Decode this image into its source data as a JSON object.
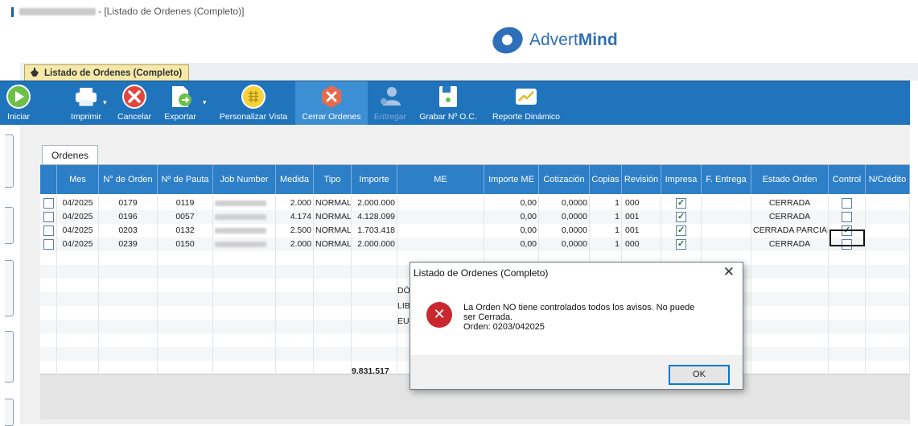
{
  "window": {
    "title": "- [Listado de Ordenes (Completo)]"
  },
  "logo": {
    "text_regular": "Advert",
    "text_bold": "Mind"
  },
  "doc_tab": {
    "label": "Listado de Ordenes (Completo)"
  },
  "ribbon": {
    "iniciar": "Iniciar",
    "imprimir": "Imprimir",
    "cancelar": "Cancelar",
    "exportar": "Exportar",
    "personalizar": "Personalizar Vista",
    "cerrar": "Cerrar Ordenes",
    "entregar": "Entregar",
    "grabar": "Grabar Nº O.C.",
    "reporte": "Reporte Dinámico"
  },
  "subtab": {
    "label": "Ordenes"
  },
  "columns": [
    "Mes",
    "N° de Orden",
    "Nº de Pauta",
    "Job Number",
    "Medida",
    "Tipo",
    "Importe",
    "ME",
    "Importe ME",
    "Cotización",
    "Copias",
    "Revisión",
    "Impresa",
    "F. Entrega",
    "Estado Orden",
    "Control",
    "N/Crédito"
  ],
  "rows": [
    {
      "sel": false,
      "mes": "04/2025",
      "orden": "0179",
      "pauta": "0119",
      "medida": "2.000",
      "tipo": "NORMAL",
      "importe": "2.000.000",
      "importe_me": "0,00",
      "cotizacion": "0,0000",
      "copias": "1",
      "revision": "000",
      "impresa": true,
      "estado": "CERRADA",
      "control": false
    },
    {
      "sel": false,
      "mes": "04/2025",
      "orden": "0196",
      "pauta": "0057",
      "medida": "4.174",
      "tipo": "NORMAL",
      "importe": "4.128.099",
      "importe_me": "0,00",
      "cotizacion": "0,0000",
      "copias": "1",
      "revision": "001",
      "impresa": true,
      "estado": "CERRADA",
      "control": false
    },
    {
      "sel": false,
      "mes": "04/2025",
      "orden": "0203",
      "pauta": "0132",
      "medida": "2.500",
      "tipo": "NORMAL",
      "importe": "1.703.418",
      "importe_me": "0,00",
      "cotizacion": "0,0000",
      "copias": "1",
      "revision": "001",
      "impresa": true,
      "estado": "CERRADA PARCIAL",
      "control": true
    },
    {
      "sel": false,
      "mes": "04/2025",
      "orden": "0239",
      "pauta": "0150",
      "medida": "2.000",
      "tipo": "NORMAL",
      "importe": "2.000.000",
      "importe_me": "0,00",
      "cotizacion": "0,0000",
      "copias": "1",
      "revision": "000",
      "impresa": true,
      "estado": "CERRADA",
      "control": false
    }
  ],
  "summary": {
    "total_importe": "9.831.517",
    "ghost_1": "DÓ",
    "ghost_2": "LIB",
    "ghost_3": "EU"
  },
  "dialog": {
    "title": "Listado de Ordenes (Completo)",
    "line1": "La Orden NO tiene controlados todos los avisos. No puede",
    "line2": "ser Cerrada.",
    "line3": "Orden: 0203/042025",
    "ok": "OK",
    "close": "✕"
  },
  "colors": {
    "ribbon": "#1f74bc",
    "header": "#2d7fc8",
    "error": "#c9282d"
  }
}
